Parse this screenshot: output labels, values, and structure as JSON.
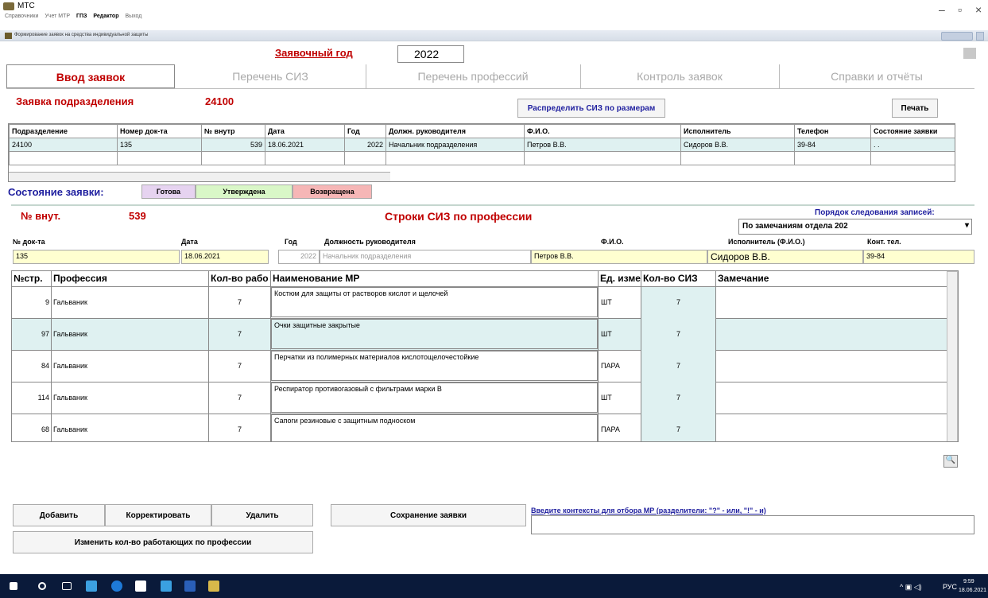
{
  "window": {
    "app_title": "МТС",
    "menu": [
      "Справочники",
      "Учет МТР",
      "ГПЗ",
      "Редактор",
      "Выход"
    ],
    "mdi_title": "Формирование заявок на средства индивидуальной защиты",
    "controls": {
      "minimize": "–",
      "maximize": "▫",
      "close": "×"
    }
  },
  "header": {
    "year_label": "Заявочный год",
    "year_value": "2022"
  },
  "tabs": [
    {
      "label": "Ввод заявок",
      "active": true
    },
    {
      "label": "Перечень СИЗ",
      "active": false
    },
    {
      "label": "Перечень профессий",
      "active": false
    },
    {
      "label": "Контроль заявок",
      "active": false
    },
    {
      "label": "Справки и отчёты",
      "active": false
    }
  ],
  "request": {
    "dept_label": "Заявка подразделения",
    "dept_value": "24100",
    "distribute_button": "Распределить СИЗ по размерам",
    "print_button": "Печать"
  },
  "upper_table": {
    "columns": [
      "Подразделение",
      "Номер док-та",
      "№ внутр",
      "Дата",
      "Год",
      "Должн. руководителя",
      "Ф.И.О.",
      "Исполнитель",
      "Телефон",
      "Состояние заявки"
    ],
    "rows": [
      [
        "24100",
        "135",
        "539",
        "18.06.2021",
        "2022",
        "Начальник подразделения",
        "Петров В.В.",
        "Сидоров В.В.",
        "39-84",
        ". ."
      ]
    ]
  },
  "status": {
    "label": "Состояние заявки:",
    "ready": "Готова",
    "approved": "Утверждена",
    "returned": "Возвращена",
    "colors": {
      "ready": "#e6d3f0",
      "approved": "#d9f7c7",
      "returned": "#f6b6b6"
    }
  },
  "detail": {
    "internal_no_label": "№ внут.",
    "internal_no_value": "539",
    "section_title": "Строки СИЗ по профессии",
    "order_label": "Порядок следования записей:",
    "order_value": "По замечаниям отдела 202",
    "doc_no_label": "№ док-та",
    "doc_no_value": "135",
    "date_label": "Дата",
    "date_value": "18.06.2021",
    "year_label": "Год",
    "year_value": "2022",
    "head_position_label": "Должность руководителя",
    "head_position_value": "Начальник подразделения",
    "fio_label": "Ф.И.О.",
    "fio_value": "Петров В.В.",
    "executor_label": "Исполнитель (Ф.И.О.)",
    "executor_value": "Сидоров В.В.",
    "phone_label": "Конт. тел.",
    "phone_value": "39-84"
  },
  "lower_table": {
    "columns": [
      "№стр.",
      "Профессия",
      "Кол-во рабо",
      "Наименование МР",
      "Ед. изме",
      "Кол-во СИЗ",
      "Замечание"
    ],
    "rows": [
      {
        "no": "9",
        "profession": "Гальваник",
        "workers": "7",
        "name": "Костюм для защиты от растворов кислот и щелочей",
        "unit": "ШТ",
        "qty": "7",
        "note": ""
      },
      {
        "no": "97",
        "profession": "Гальваник",
        "workers": "7",
        "name": "Очки защитные закрытые",
        "unit": "ШТ",
        "qty": "7",
        "note": "",
        "selected": true
      },
      {
        "no": "84",
        "profession": "Гальваник",
        "workers": "7",
        "name": "Перчатки из полимерных материалов кислотощелочестойкие",
        "unit": "ПАРА",
        "qty": "7",
        "note": ""
      },
      {
        "no": "114",
        "profession": "Гальваник",
        "workers": "7",
        "name": "Респиратор противогазовый с фильтрами марки В",
        "unit": "ШТ",
        "qty": "7",
        "note": ""
      },
      {
        "no": "68",
        "profession": "Гальваник",
        "workers": "7",
        "name": "Сапоги резиновые с защитным подноском",
        "unit": "ПАРА",
        "qty": "7",
        "note": ""
      }
    ]
  },
  "actions": {
    "add": "Добавить",
    "edit": "Корректировать",
    "delete": "Удалить",
    "save": "Сохранение заявки",
    "change_workers": "Изменить кол-во работающих по профессии",
    "filter_label": "Введите контексты для отбора МР (разделители: \"?\" - или, \"!\" - и)",
    "filter_value": ""
  },
  "taskbar": {
    "lang": "РУС",
    "time": "9:59",
    "date": "18.06.2021"
  }
}
